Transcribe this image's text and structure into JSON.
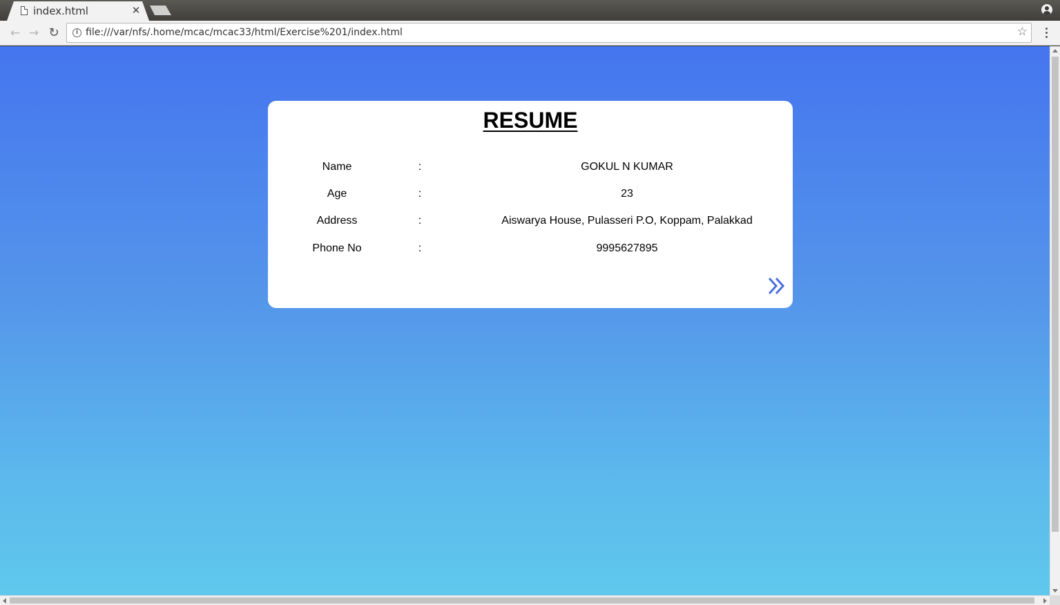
{
  "browser": {
    "tab": {
      "title": "index.html",
      "close_glyph": "✕"
    },
    "toolbar": {
      "back_glyph": "←",
      "forward_glyph": "→",
      "reload_glyph": "↻",
      "info_glyph": "i",
      "url": "file:///var/nfs/.home/mcac/mcac33/html/Exercise%201/index.html",
      "star_glyph": "☆"
    },
    "icons": [
      "file-icon",
      "close-icon",
      "new-tab-icon",
      "profile-icon",
      "back-arrow-icon",
      "forward-arrow-icon",
      "reload-icon",
      "info-icon",
      "bookmark-star-icon",
      "menu-dots-icon",
      "double-chevron-right-icon"
    ]
  },
  "page": {
    "background_colors": [
      "#4575ef",
      "#5fc8ec"
    ],
    "accent_color": "#4a6fe0",
    "resume": {
      "title": "RESUME",
      "fields": [
        {
          "label": "Name",
          "separator": ":",
          "value": "GOKUL N KUMAR"
        },
        {
          "label": "Age",
          "separator": ":",
          "value": "23"
        },
        {
          "label": "Address",
          "separator": ":",
          "value": "Aiswarya House, Pulasseri P.O, Koppam, Palakkad"
        },
        {
          "label": "Phone No",
          "separator": ":",
          "value": "9995627895"
        }
      ]
    }
  }
}
